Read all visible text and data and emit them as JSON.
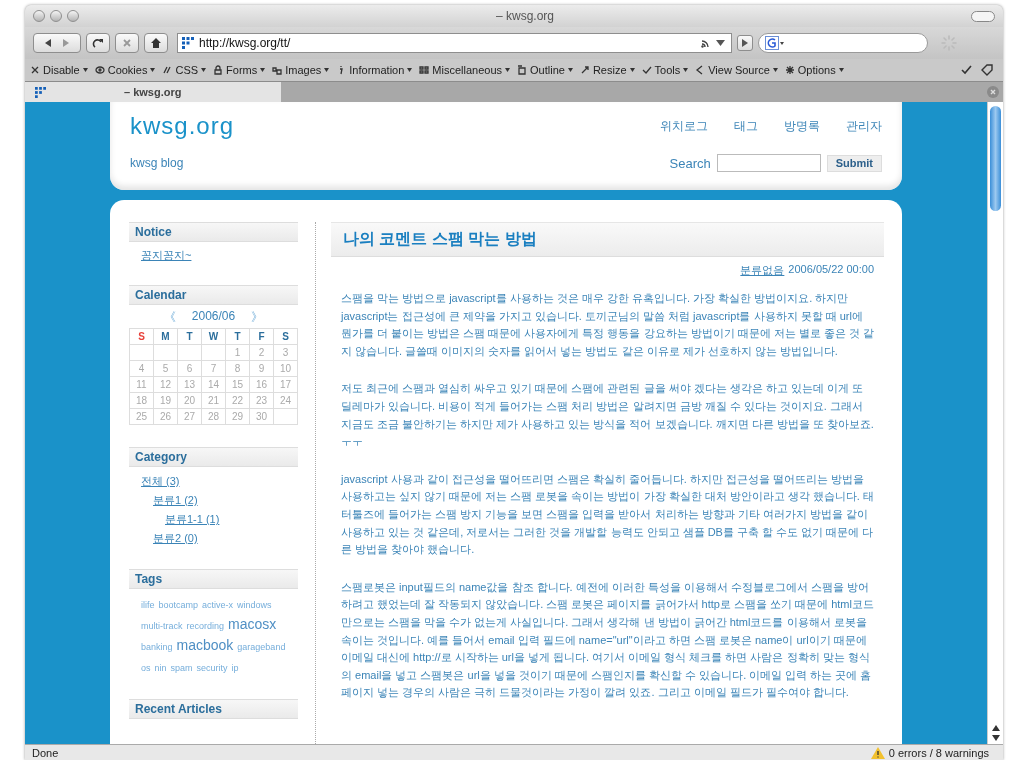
{
  "window": {
    "title": "– kwsg.org"
  },
  "address_bar": {
    "url": "http://kwsg.org/tt/"
  },
  "dev_toolbar": [
    {
      "label": "Disable"
    },
    {
      "label": "Cookies"
    },
    {
      "label": "CSS"
    },
    {
      "label": "Forms"
    },
    {
      "label": "Images"
    },
    {
      "label": "Information"
    },
    {
      "label": "Miscellaneous"
    },
    {
      "label": "Outline"
    },
    {
      "label": "Resize"
    },
    {
      "label": "Tools"
    },
    {
      "label": "View Source"
    },
    {
      "label": "Options"
    }
  ],
  "tabs": [
    {
      "title": "– kwsg.org",
      "selected": true
    }
  ],
  "header": {
    "site_title": "kwsg.org",
    "tagline": "kwsg blog",
    "nav": [
      "위치로그",
      "태그",
      "방명록",
      "관리자"
    ],
    "search_label": "Search",
    "submit": "Submit"
  },
  "sidebar": {
    "notice": {
      "title": "Notice",
      "items": [
        "꽁지꽁지~"
      ]
    },
    "calendar": {
      "title": "Calendar",
      "prev": "《",
      "month": "2006/06",
      "next": "》",
      "weekdays": [
        {
          "label": "S",
          "color": "#e8413a"
        },
        {
          "label": "M",
          "color": "#2b6e9c"
        },
        {
          "label": "T",
          "color": "#2b6e9c"
        },
        {
          "label": "W",
          "color": "#2b6e9c"
        },
        {
          "label": "T",
          "color": "#2b6e9c"
        },
        {
          "label": "F",
          "color": "#2b6e9c"
        },
        {
          "label": "S",
          "color": "#2b6e9c"
        }
      ],
      "weeks": [
        [
          "1",
          "2",
          "3"
        ],
        [
          "4",
          "5",
          "6",
          "7",
          "8",
          "9",
          "10"
        ],
        [
          "11",
          "12",
          "13",
          "14",
          "15",
          "16",
          "17"
        ],
        [
          "18",
          "19",
          "20",
          "21",
          "22",
          "23",
          "24"
        ],
        [
          "25",
          "26",
          "27",
          "28",
          "29",
          "30"
        ]
      ]
    },
    "category": {
      "title": "Category",
      "items": [
        {
          "label": "전체 (3)",
          "children": [
            {
              "label": "분류1 (2)",
              "children": [
                {
                  "label": "분류1-1 (1)"
                }
              ]
            },
            {
              "label": "분류2 (0)"
            }
          ]
        }
      ]
    },
    "tags": {
      "title": "Tags",
      "items": [
        {
          "text": "ilife",
          "kind": "small"
        },
        {
          "text": "bootcamp",
          "kind": "small"
        },
        {
          "text": "active-x",
          "kind": "small"
        },
        {
          "text": "windows",
          "kind": "small"
        },
        {
          "text": "multi-track",
          "kind": "small"
        },
        {
          "text": "recording",
          "kind": "small"
        },
        {
          "text": "macosx",
          "kind": "large"
        },
        {
          "text": "banking",
          "kind": "small"
        },
        {
          "text": "macbook",
          "kind": "large"
        },
        {
          "text": "garageband",
          "kind": "small"
        },
        {
          "text": "os",
          "kind": "small"
        },
        {
          "text": "nin",
          "kind": "small"
        },
        {
          "text": "spam",
          "kind": "small"
        },
        {
          "text": "security",
          "kind": "small"
        },
        {
          "text": "ip",
          "kind": "small"
        }
      ]
    },
    "recent": {
      "title": "Recent Articles"
    }
  },
  "post": {
    "title": "나의 코멘트 스팸 막는 방법",
    "category": "분류없음",
    "date": "2006/05/22 00:00",
    "paragraphs": [
      "스팸을 막는 방법으로 javascript를 사용하는 것은 매우 강한 유혹입니다. 가장 확실한 방법이지요. 하지만 javascript는 접근성에 큰 제약을 가지고 있습니다. 토끼군님의 말씀 처럼 javascript를 사용하지 못할 때 url에 뭔가를 더 붙이는 방법은 스팸 때문에 사용자에게 특정 행동을 강요하는 방법이기 때문에 저는 별로 좋은 것 같지 않습니다. 글쓸때 이미지의 숫자를 읽어서 넣는 방법도 같은 이유로 제가 선호하지 않는 방법입니다.",
      "저도 최근에 스팸과 열심히 싸우고 있기 때문에 스팸에 관련된 글을 써야 겠다는 생각은 하고 있는데 이게 또 딜레마가 있습니다. 비용이 적게 들어가는 스팸 처리 방법은 알려지면 금방 깨질 수 있다는 것이지요. 그래서 지금도 조금 불안하기는 하지만 제가 사용하고 있는 방식을 적어 보겠습니다. 깨지면 다른 방법을 또 찾아보죠. ㅜㅜ",
      "javascript 사용과 같이 접근성을 떨어뜨리면 스팸은 확실히 줄어듭니다. 하지만 접근성을 떨어뜨리는 방법을 사용하고는 싶지 않기 때문에 저는 스팸 로봇을 속이는 방법이 가장 확실한 대처 방안이라고 생각 했습니다. 태터툴즈에 들어가는 스팸 방지 기능을 보면 스팸을 입력을 받아서 처리하는 방향과 기타 여러가지 방법을 같이 사용하고 있는 것 같은데, 저로서는 그러한 것을 개발할 능력도 안되고 샘플 DB를 구축 할 수도 없기 때문에 다른 방법을 찾아야 했습니다.",
      "스팸로봇은 input필드의 name값을 참조 합니다. 예전에 이러한 특성을 이용해서 수정블로그에서 스팸을 방어하려고 했었는데 잘 작동되지 않았습니다. 스팸 로봇은 페이지를 긁어가서 http로 스팸을 쏘기 때문에 html코드만으로는 스팸을 막을 수가 없는게 사실입니다. 그래서 생각해 낸 방법이 긁어간 html코드를 이용해서 로봇을 속이는 것입니다. 예를 들어서 email 입력 필드에 name=\"url\"이라고 하면 스팸 로봇은 name이 url이기 때문에 이메일 대신에 http://로 시작하는 url을 넣게 됩니다. 여기서 이메일 형식 체크를 하면 사람은 정확히 맞는 형식의 email을 넣고 스팸봇은 url을 넣을 것이기 때문에 스팸인지를 확신할 수 있습니다. 이메일 입력 하는 곳에 홈페이지 넣는 경우의 사람은 극히 드물것이라는 가정이 깔려 있죠. 그리고 이메일 필드가 필수여야 합니다."
    ]
  },
  "status_bar": {
    "text": "Done",
    "warnings": "0 errors / 8 warnings"
  }
}
